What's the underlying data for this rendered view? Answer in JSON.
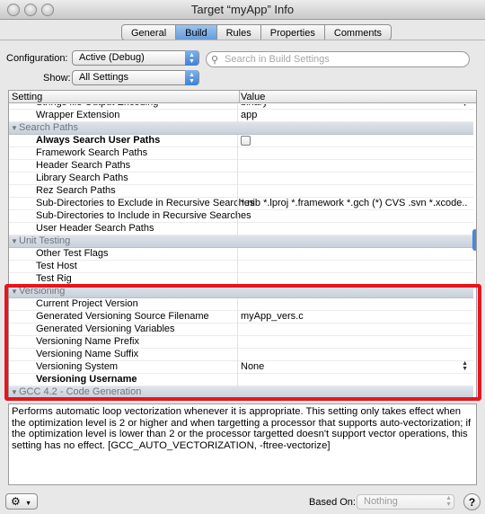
{
  "window": {
    "title": "Target “myApp” Info"
  },
  "tabs": [
    "General",
    "Build",
    "Rules",
    "Properties",
    "Comments"
  ],
  "active_tab": "Build",
  "configuration": {
    "label": "Configuration:",
    "value": "Active (Debug)"
  },
  "show": {
    "label": "Show:",
    "value": "All Settings"
  },
  "search": {
    "placeholder": "Search in Build Settings"
  },
  "table": {
    "col_setting": "Setting",
    "col_value": "Value",
    "rows": [
      {
        "type": "row",
        "setting": "Strings file Output Encoding",
        "value": "binary"
      },
      {
        "type": "row",
        "setting": "Wrapper Extension",
        "value": "app"
      },
      {
        "type": "group",
        "setting": "Search Paths"
      },
      {
        "type": "row",
        "setting": "Always Search User Paths",
        "value": "",
        "bold": true,
        "checkbox": true
      },
      {
        "type": "row",
        "setting": "Framework Search Paths",
        "value": ""
      },
      {
        "type": "row",
        "setting": "Header Search Paths",
        "value": ""
      },
      {
        "type": "row",
        "setting": "Library Search Paths",
        "value": ""
      },
      {
        "type": "row",
        "setting": "Rez Search Paths",
        "value": ""
      },
      {
        "type": "row",
        "setting": "Sub-Directories to Exclude in Recursive Searches",
        "value": "*.nib *.lproj *.framework *.gch (*) CVS .svn *.xcode..."
      },
      {
        "type": "row",
        "setting": "Sub-Directories to Include in Recursive Searches",
        "value": ""
      },
      {
        "type": "row",
        "setting": "User Header Search Paths",
        "value": ""
      },
      {
        "type": "group",
        "setting": "Unit Testing"
      },
      {
        "type": "row",
        "setting": "Other Test Flags",
        "value": ""
      },
      {
        "type": "row",
        "setting": "Test Host",
        "value": ""
      },
      {
        "type": "row",
        "setting": "Test Rig",
        "value": ""
      },
      {
        "type": "group",
        "setting": "Versioning"
      },
      {
        "type": "row",
        "setting": "Current Project Version",
        "value": ""
      },
      {
        "type": "row",
        "setting": "Generated Versioning Source Filename",
        "value": "myApp_vers.c"
      },
      {
        "type": "row",
        "setting": "Generated Versioning Variables",
        "value": ""
      },
      {
        "type": "row",
        "setting": "Versioning Name Prefix",
        "value": ""
      },
      {
        "type": "row",
        "setting": "Versioning Name Suffix",
        "value": ""
      },
      {
        "type": "row",
        "setting": "Versioning System",
        "value": "None",
        "stepper": true
      },
      {
        "type": "row",
        "setting": "Versioning Username",
        "value": "",
        "bold": true
      },
      {
        "type": "group",
        "setting": "GCC 4.2 - Code Generation"
      }
    ]
  },
  "description": "Performs automatic loop vectorization whenever it is appropriate.  This setting only takes effect when the optimization level is 2 or higher and when targetting a processor that supports auto-vectorization; if the optimization level is lower than 2 or the processor targetted doesn't support vector operations, this setting has no effect. [GCC_AUTO_VECTORIZATION, -ftree-vectorize]",
  "bottom": {
    "based_on_label": "Based On:",
    "based_on_value": "Nothing",
    "help": "?"
  },
  "colors": {
    "highlight": "#e8141e",
    "accent": "#5f97d8"
  }
}
